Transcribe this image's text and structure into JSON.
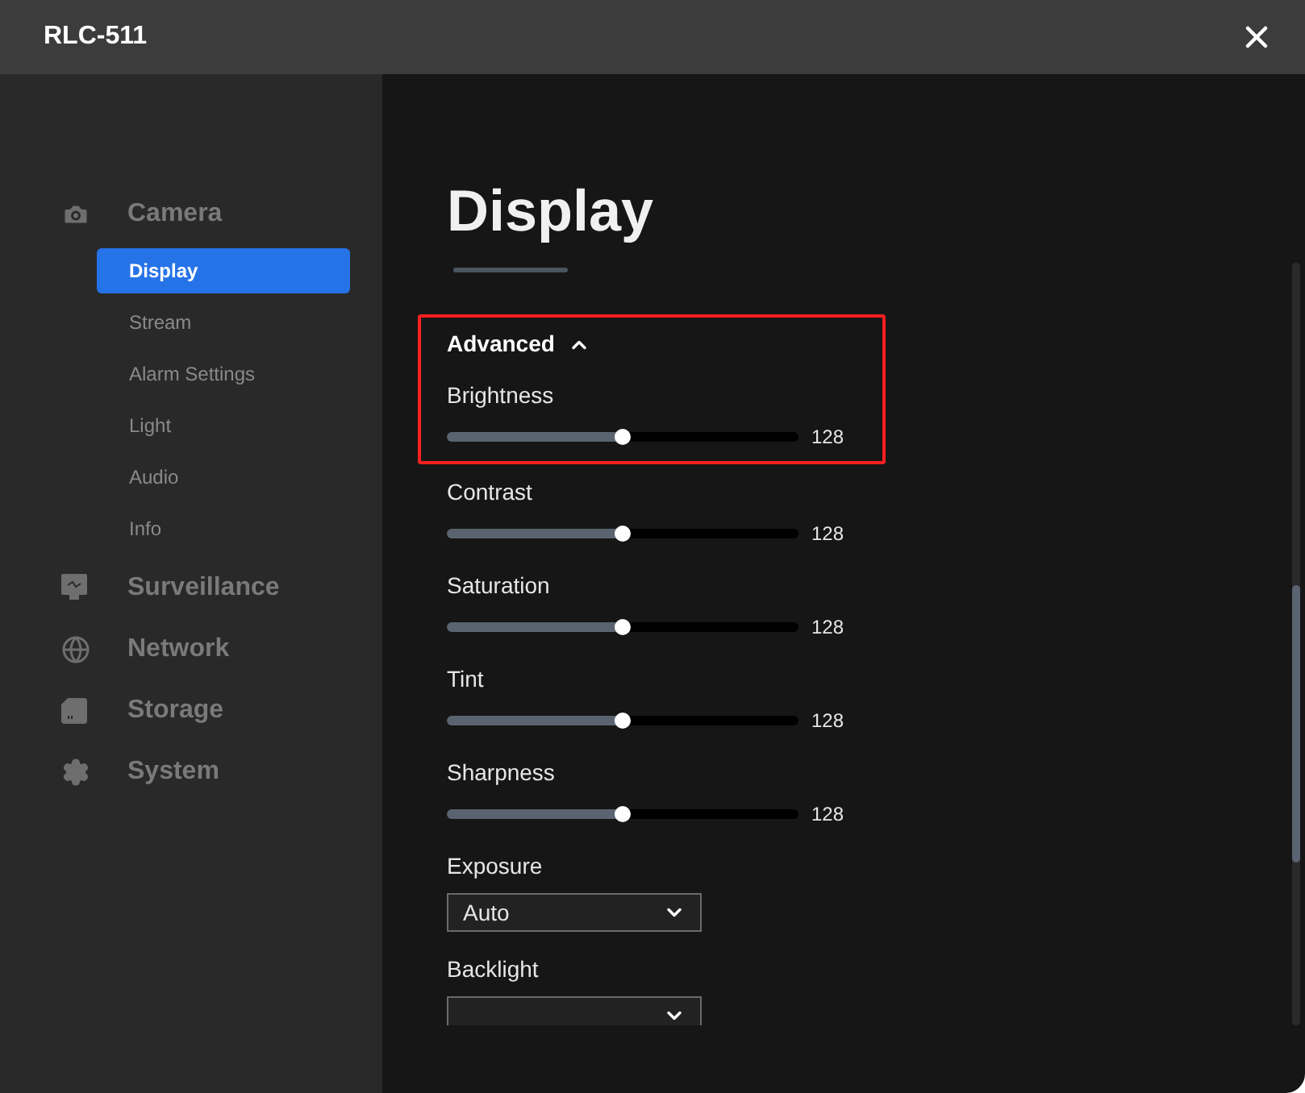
{
  "window": {
    "title": "RLC-511"
  },
  "sidebar": {
    "sections": [
      {
        "label": "Camera",
        "children": [
          {
            "label": "Display",
            "selected": true
          },
          {
            "label": "Stream",
            "selected": false
          },
          {
            "label": "Alarm Settings",
            "selected": false
          },
          {
            "label": "Light",
            "selected": false
          },
          {
            "label": "Audio",
            "selected": false
          },
          {
            "label": "Info",
            "selected": false
          }
        ]
      },
      {
        "label": "Surveillance"
      },
      {
        "label": "Network"
      },
      {
        "label": "Storage"
      },
      {
        "label": "System"
      }
    ]
  },
  "page": {
    "title": "Display",
    "advanced": {
      "label": "Advanced",
      "expanded": true,
      "highlighted": true
    },
    "settings": [
      {
        "kind": "slider",
        "label": "Brightness",
        "level": 0.5,
        "reading": "128"
      },
      {
        "kind": "slider",
        "label": "Contrast",
        "level": 0.5,
        "reading": "128"
      },
      {
        "kind": "slider",
        "label": "Saturation",
        "level": 0.5,
        "reading": "128"
      },
      {
        "kind": "slider",
        "label": "Tint",
        "level": 0.5,
        "reading": "128"
      },
      {
        "kind": "slider",
        "label": "Sharpness",
        "level": 0.5,
        "reading": "128"
      },
      {
        "kind": "select",
        "label": "Exposure",
        "value": "Auto"
      },
      {
        "kind": "select",
        "label": "Backlight"
      }
    ]
  }
}
